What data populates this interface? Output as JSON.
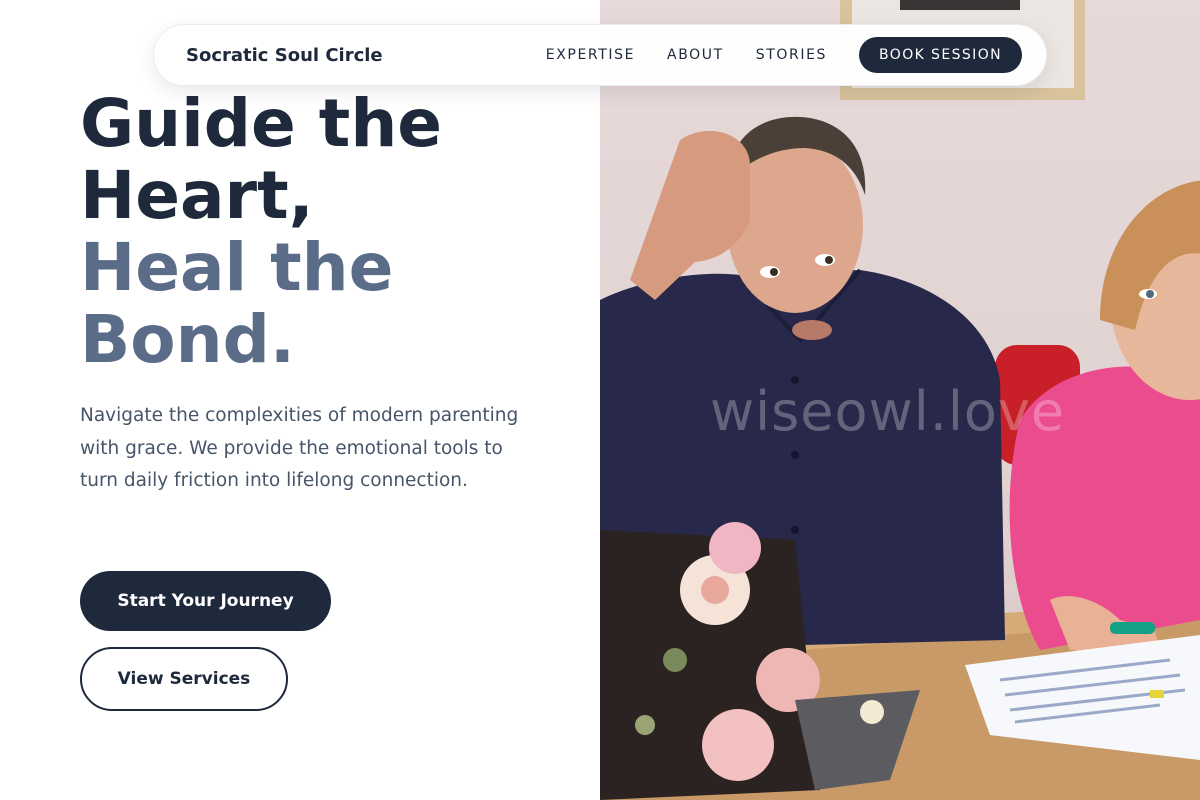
{
  "nav": {
    "brand": "Socratic Soul Circle",
    "links": [
      {
        "label": "EXPERTISE"
      },
      {
        "label": "ABOUT"
      },
      {
        "label": "STORIES"
      }
    ],
    "cta_label": "BOOK SESSION"
  },
  "hero": {
    "headline_lines": [
      "Guide the",
      "Heart,"
    ],
    "headline_accent_lines": [
      "Heal the",
      "Bond."
    ],
    "lead": "Navigate the complexities of modern parenting with grace. We provide the emotional tools to turn daily friction into lifelong connection.",
    "primary_cta": "Start Your Journey",
    "secondary_cta": "View Services"
  },
  "photo": {
    "watermark": "wiseowl.love"
  },
  "colors": {
    "primary": "#1e293b",
    "accent_text": "#5a6c87",
    "body_text": "#465569",
    "background": "#ffffff"
  }
}
